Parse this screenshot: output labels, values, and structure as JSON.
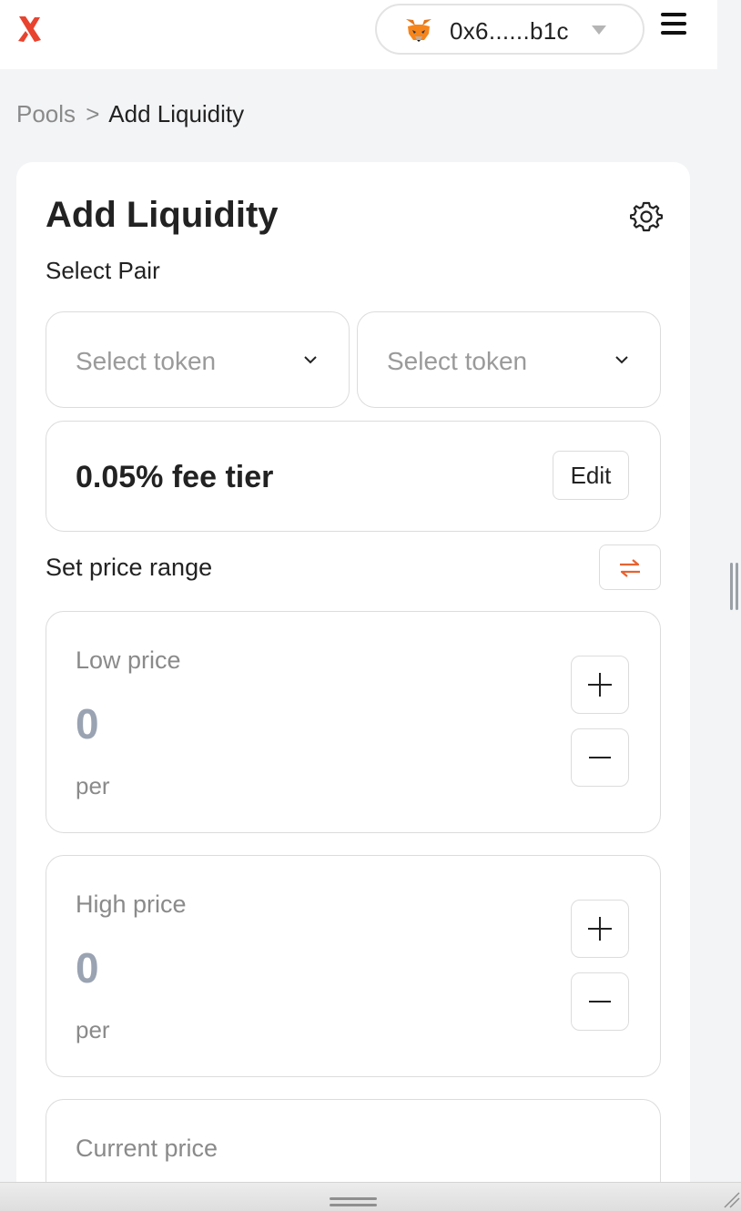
{
  "header": {
    "logo_icon": "x-logo-icon",
    "brand_color": "#e8432f",
    "wallet": {
      "icon": "metamask-fox-icon",
      "address": "0x6......b1c",
      "dropdown_icon": "caret-down-icon"
    },
    "menu_icon": "hamburger-menu-icon"
  },
  "breadcrumb": {
    "parent": "Pools",
    "separator": ">",
    "current": "Add Liquidity"
  },
  "card": {
    "title": "Add Liquidity",
    "settings_icon": "gear-icon",
    "select_pair_label": "Select Pair",
    "token_a": {
      "placeholder": "Select token",
      "icon": "chevron-down-icon"
    },
    "token_b": {
      "placeholder": "Select token",
      "icon": "chevron-down-icon"
    },
    "fee": {
      "text": "0.05% fee tier",
      "edit_label": "Edit"
    },
    "price_range": {
      "label": "Set price range",
      "swap_icon": "swap-arrows-icon",
      "accent_color": "#e8622f"
    },
    "low_price": {
      "label": "Low price",
      "value": "0",
      "unit": "per"
    },
    "high_price": {
      "label": "High price",
      "value": "0",
      "unit": "per"
    },
    "current_price": {
      "label": "Current price"
    }
  }
}
